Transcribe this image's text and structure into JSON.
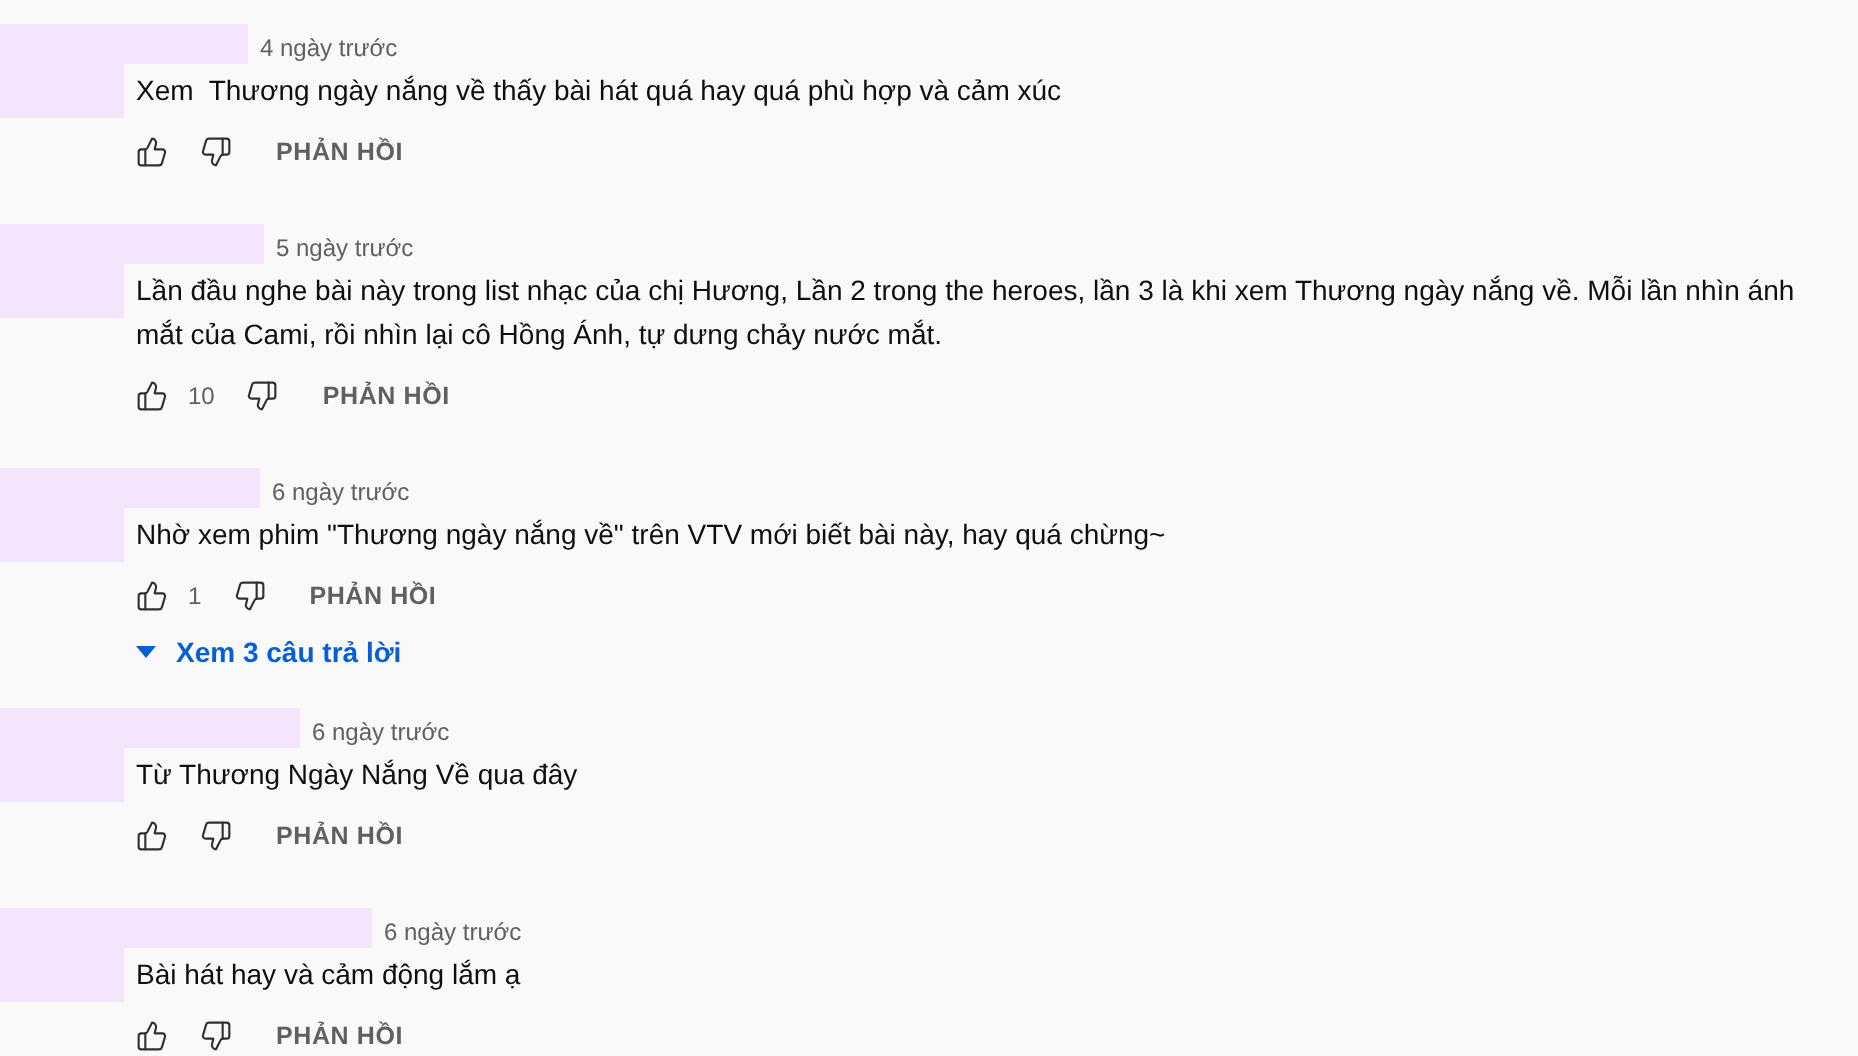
{
  "comments": [
    {
      "time": "4 ngày trước",
      "text": "Xem  Thương ngày nắng về thấy bài hát quá hay quá phù hợp và cảm xúc",
      "reply": "PHẢN HỒI"
    },
    {
      "time": "5 ngày trước",
      "text": "Lần đầu nghe bài này trong list nhạc của chị Hương, Lần 2 trong the heroes, lần 3 là khi xem Thương ngày nắng về. Mỗi lần nhìn ánh mắt của Cami, rồi nhìn lại cô Hồng Ánh, tự dưng chảy nước mắt.",
      "likes": "10",
      "reply": "PHẢN HỒI"
    },
    {
      "time": "6 ngày trước",
      "text": "Nhờ xem phim \"Thương ngày nắng về\" trên VTV mới biết bài này, hay quá chừng~",
      "likes": "1",
      "reply": "PHẢN HỒI",
      "replies": "Xem 3 câu trả lời"
    },
    {
      "time": "6 ngày trước",
      "text": "Từ Thương Ngày Nắng Về qua đây",
      "reply": "PHẢN HỒI"
    },
    {
      "time": "6 ngày trước",
      "text": "Bài hát hay và cảm động lắm ạ",
      "reply": "PHẢN HỒI"
    }
  ]
}
